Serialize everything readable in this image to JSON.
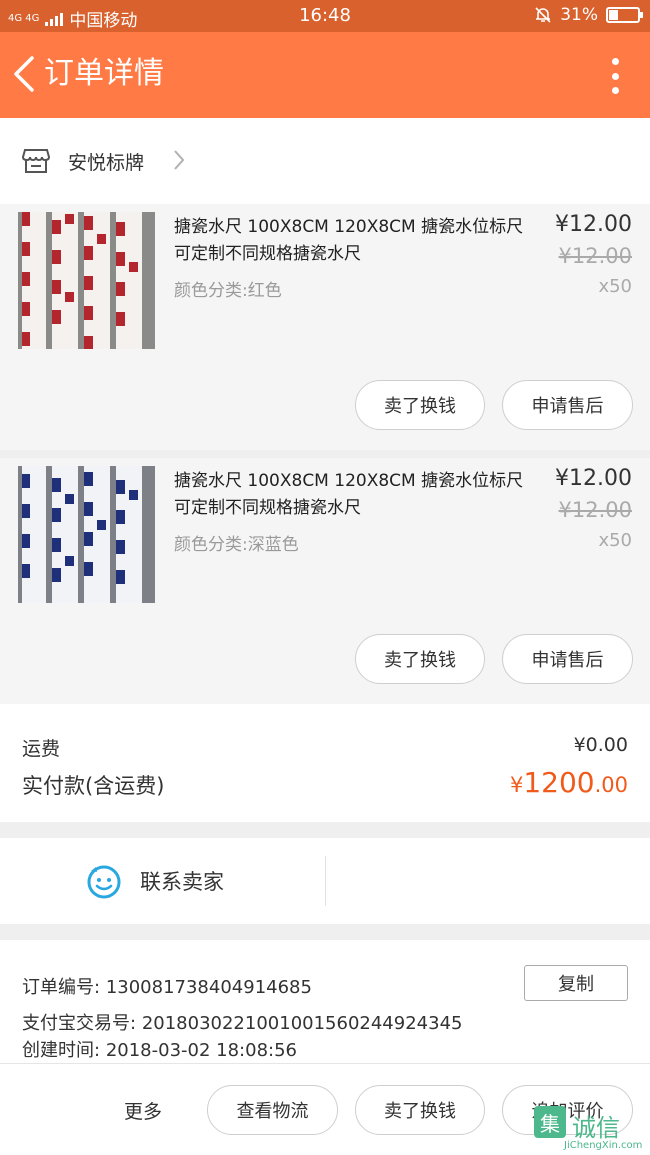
{
  "status_bar": {
    "network": "4G 4G",
    "carrier": "中国移动",
    "time": "16:48",
    "battery": "31%"
  },
  "header": {
    "title": "订单详情"
  },
  "shop": {
    "name": "安悦标牌"
  },
  "items": [
    {
      "title": "搪瓷水尺 100X8CM 120X8CM 搪瓷水位标尺可定制不同规格搪瓷水尺",
      "variant": "颜色分类:红色",
      "price": "¥12.00",
      "original_price": "¥12.00",
      "quantity": "x50",
      "button_exchange": "卖了换钱",
      "button_after_sale": "申请售后",
      "thumb_color": "#b3262e"
    },
    {
      "title": "搪瓷水尺 100X8CM 120X8CM 搪瓷水位标尺可定制不同规格搪瓷水尺",
      "variant": "颜色分类:深蓝色",
      "price": "¥12.00",
      "original_price": "¥12.00",
      "quantity": "x50",
      "button_exchange": "卖了换钱",
      "button_after_sale": "申请售后",
      "thumb_color": "#1f2f7a"
    }
  ],
  "totals": {
    "shipping_label": "运费",
    "shipping_value": "¥0.00",
    "paid_label": "实付款(含运费)",
    "paid_currency": "¥",
    "paid_integer": "1200",
    "paid_decimal": ".00"
  },
  "contact": {
    "label": "联系卖家"
  },
  "order_info": {
    "order_no_label": "订单编号:",
    "order_no": "130081738404914685",
    "copy_label": "复制",
    "alipay_label": "支付宝交易号:",
    "alipay_no": "2018030221001001560244924345",
    "created_label": "创建时间:",
    "created_time": "2018-03-02 18:08:56"
  },
  "bottom_bar": {
    "more": "更多",
    "logistics": "查看物流",
    "sell": "卖了换钱",
    "review": "追加评价"
  },
  "watermark": {
    "logo": "集",
    "name": "诚信",
    "url": "JiChengXin.com"
  },
  "colors": {
    "header": "#ff7a45",
    "price_accent": "#f05a1a",
    "contact_icon": "#29a8e0"
  }
}
